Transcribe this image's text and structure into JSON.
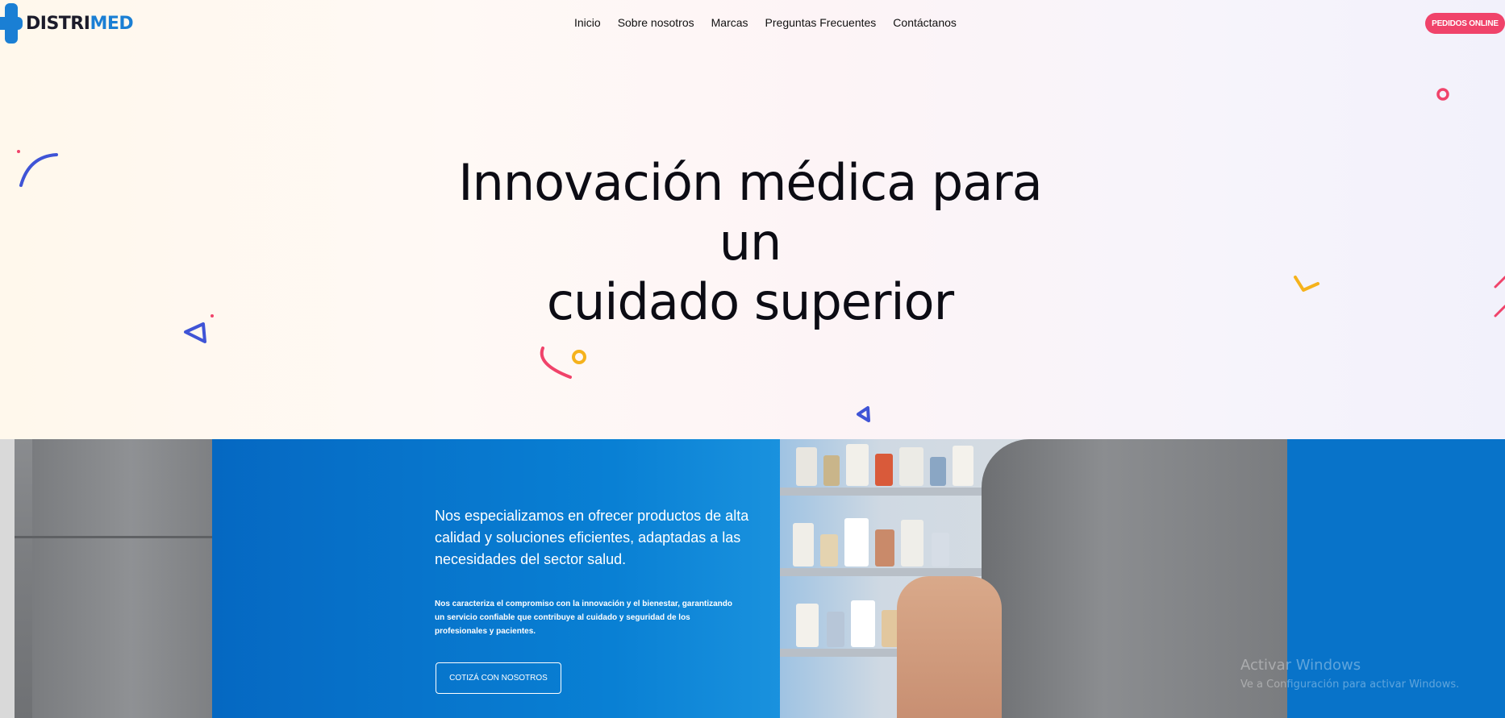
{
  "header": {
    "logo": {
      "part1": "DISTRI",
      "part2": "MED"
    },
    "nav": [
      {
        "label": "Inicio"
      },
      {
        "label": "Sobre nosotros"
      },
      {
        "label": "Marcas"
      },
      {
        "label": "Preguntas Frecuentes"
      },
      {
        "label": "Contáctanos"
      }
    ],
    "cta_label": "PEDIDOS ONLINE"
  },
  "hero": {
    "line1": "Innovación médica para",
    "line2": "un",
    "line3": "cuidado superior"
  },
  "band": {
    "text": "Nos especializamos en ofrecer productos de alta calidad y soluciones eficientes, adaptadas a las necesidades del sector salud.",
    "small_text": "Nos caracteriza el compromiso con la innovación y el bienestar, garantizando un servicio confiable que contribuye al cuidado y seguridad de los profesionales y pacientes.",
    "button_label": "COTIZÁ CON NOSOTROS"
  },
  "watermark": {
    "title": "Activar Windows",
    "subtitle": "Ve a Configuración para activar Windows."
  },
  "colors": {
    "brand_blue": "#1a7fd4",
    "cta_pink": "#f0436a",
    "band_blue": "#0873c9"
  }
}
